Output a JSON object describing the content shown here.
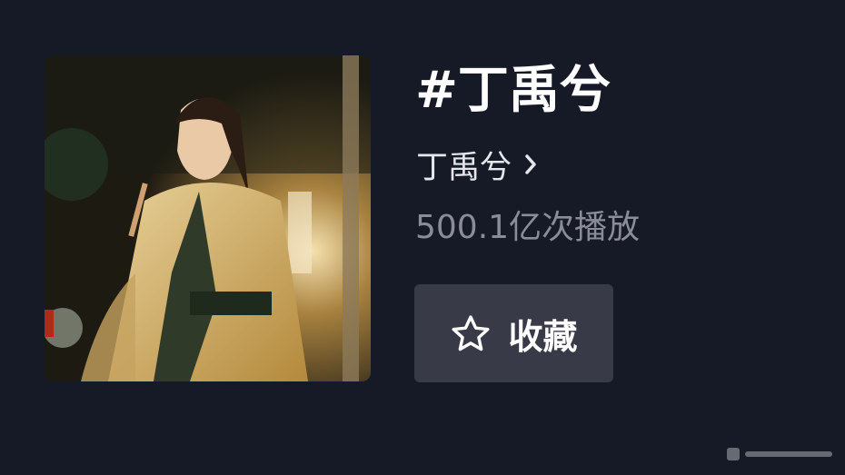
{
  "topic": {
    "title": "#丁禹兮",
    "creator_name": "丁禹兮",
    "play_count": "500.1亿次播放",
    "favorite_label": "收藏"
  },
  "icons": {
    "creator_chevron": "chevron-right-icon",
    "favorite": "star-outline-icon"
  },
  "colors": {
    "background": "#161a26",
    "button_background": "#393a47",
    "title_text": "#ffffff",
    "secondary_text": "#8a8d99"
  }
}
